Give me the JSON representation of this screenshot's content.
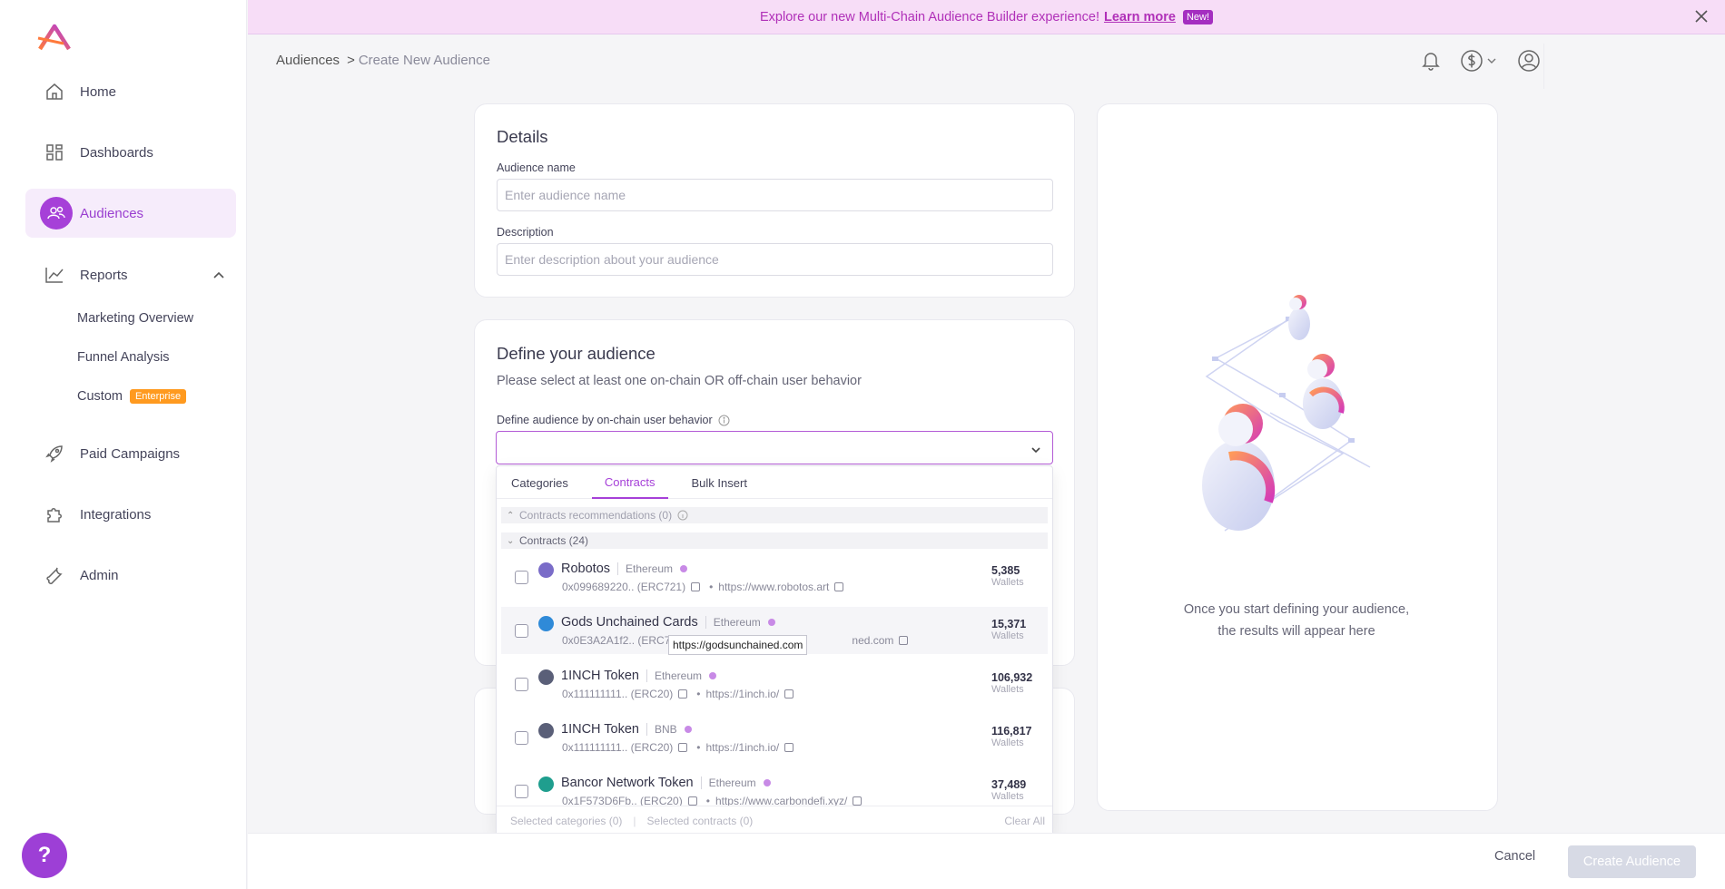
{
  "banner": {
    "text": "Explore our new Multi-Chain Audience Builder experience!",
    "link": "Learn more",
    "badge": "New!"
  },
  "sidebar": {
    "items": [
      {
        "label": "Home",
        "icon": "home-icon"
      },
      {
        "label": "Dashboards",
        "icon": "grid-icon"
      },
      {
        "label": "Audiences",
        "icon": "users-icon",
        "active": true
      },
      {
        "label": "Reports",
        "icon": "chart-icon",
        "expanded": true
      },
      {
        "label": "Paid Campaigns",
        "icon": "rocket-icon"
      },
      {
        "label": "Integrations",
        "icon": "puzzle-icon"
      },
      {
        "label": "Admin",
        "icon": "wrench-icon"
      }
    ],
    "report_subitems": [
      {
        "label": "Marketing Overview"
      },
      {
        "label": "Funnel Analysis"
      },
      {
        "label": "Custom",
        "badge": "Enterprise"
      }
    ],
    "help": "?"
  },
  "breadcrumb": {
    "root": "Audiences",
    "separator": ">",
    "current": "Create New Audience"
  },
  "details": {
    "title": "Details",
    "name_label": "Audience name",
    "name_placeholder": "Enter audience name",
    "description_label": "Description",
    "description_placeholder": "Enter description about your audience"
  },
  "define": {
    "title": "Define your audience",
    "subtitle": "Please select at least one on-chain OR off-chain user behavior",
    "onchain_label": "Define audience by on-chain user behavior"
  },
  "dropdown": {
    "tabs": [
      "Categories",
      "Contracts",
      "Bulk Insert"
    ],
    "active_tab": "Contracts",
    "recommendations_header": "Contracts recommendations (0)",
    "contracts_header": "Contracts (24)",
    "contracts": [
      {
        "name": "Robotos",
        "chain": "Ethereum",
        "address": "0x099689220.. (ERC721)",
        "url": "https://www.robotos.art",
        "wallets": "5,385",
        "icon_color": "#7a6cc8"
      },
      {
        "name": "Gods Unchained Cards",
        "chain": "Ethereum",
        "address": "0x0E3A2A1f2.. (ERC7",
        "url": "ned.com",
        "wallets": "15,371",
        "icon_color": "#2f8ad8"
      },
      {
        "name": "1INCH Token",
        "chain": "Ethereum",
        "address": "0x111111111.. (ERC20)",
        "url": "https://1inch.io/",
        "wallets": "106,932",
        "icon_color": "#5a5f78"
      },
      {
        "name": "1INCH Token",
        "chain": "BNB",
        "address": "0x111111111.. (ERC20)",
        "url": "https://1inch.io/",
        "wallets": "116,817",
        "icon_color": "#5a5f78"
      },
      {
        "name": "Bancor Network Token",
        "chain": "Ethereum",
        "address": "0x1F573D6Fb.. (ERC20)",
        "url": "https://www.carbondefi.xyz/",
        "wallets": "37,489",
        "icon_color": "#1f9e8e"
      }
    ],
    "wallets_label": "Wallets",
    "tooltip": "https://godsunchained.com",
    "footer": {
      "selected_categories": "Selected categories (0)",
      "selected_contracts": "Selected contracts (0)",
      "clear": "Clear All"
    }
  },
  "empty_state": {
    "line1": "Once you start defining your audience,",
    "line2": "the results will appear here"
  },
  "actions": {
    "cancel": "Cancel",
    "create": "Create Audience"
  },
  "colors": {
    "accent": "#a640d8",
    "banner_bg": "#f7ddf7",
    "enterprise_badge": "#ff9a1f"
  }
}
